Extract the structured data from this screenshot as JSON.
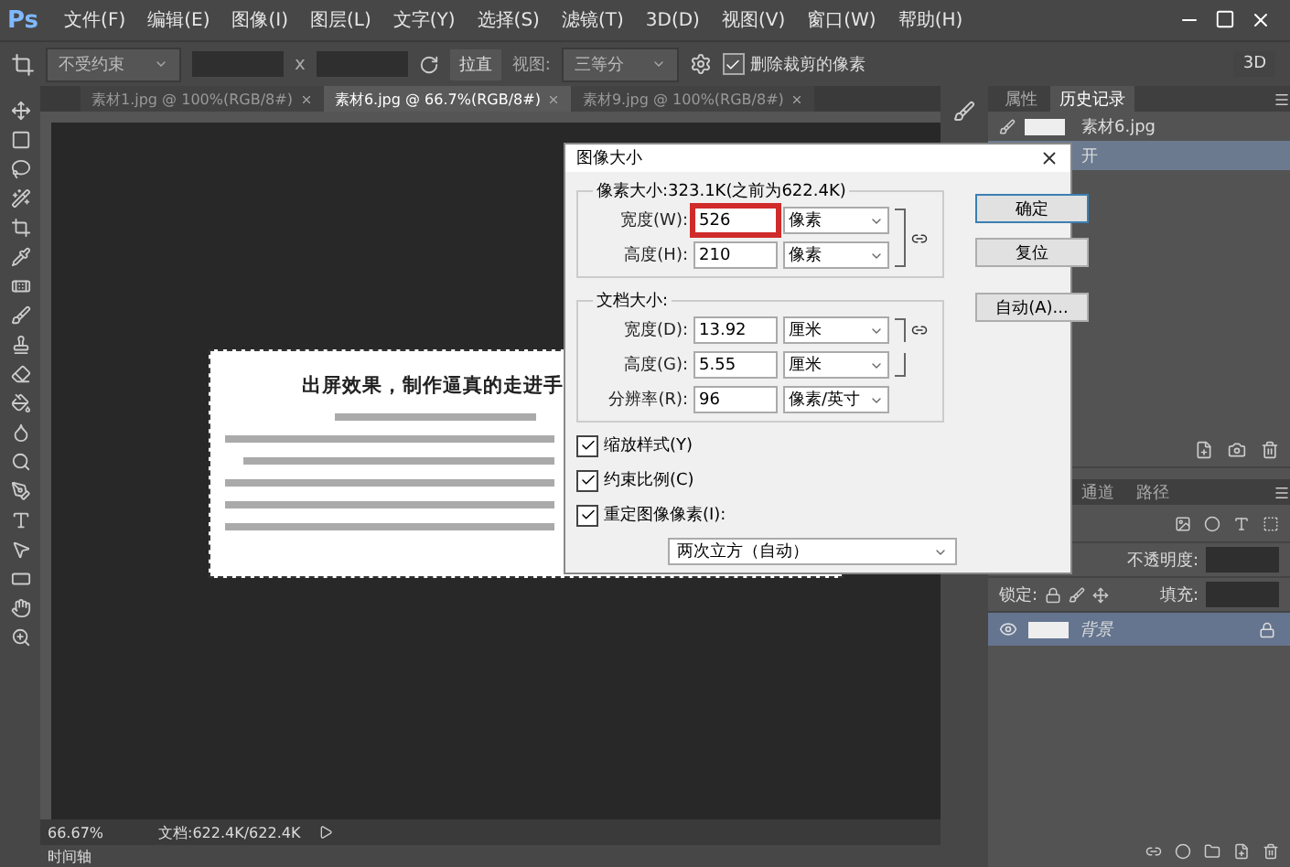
{
  "app": {
    "logo": "Ps"
  },
  "menu": [
    "文件(F)",
    "编辑(E)",
    "图像(I)",
    "图层(L)",
    "文字(Y)",
    "选择(S)",
    "滤镜(T)",
    "3D(D)",
    "视图(V)",
    "窗口(W)",
    "帮助(H)"
  ],
  "options_bar": {
    "ratio": "不受约束",
    "separator": "x",
    "straighten": "拉直",
    "view_label": "视图:",
    "view": "三等分",
    "delete_cropped": {
      "label": "删除裁剪的像素",
      "checked": true
    },
    "mode": "3D"
  },
  "doc_tabs": [
    {
      "label": "素材1.jpg @ 100%(RGB/8#)",
      "selected": false
    },
    {
      "label": "素材6.jpg @ 66.7%(RGB/8#)",
      "selected": true
    },
    {
      "label": "素材9.jpg @ 100%(RGB/8#)",
      "selected": false
    }
  ],
  "document": {
    "title": "出屏效果，制作逼真的走进手"
  },
  "history_panel": {
    "tabs": [
      {
        "label": "属性",
        "selected": false
      },
      {
        "label": "历史记录",
        "selected": true
      }
    ],
    "items": [
      {
        "kind": "snapshot",
        "label": "素材6.jpg",
        "selected": false
      },
      {
        "kind": "step",
        "label": "开",
        "selected": true
      }
    ]
  },
  "layers_panel": {
    "tabs": [
      {
        "label": "通道",
        "selected": false
      },
      {
        "label": "路径",
        "selected": false
      }
    ],
    "opacity_label": "不透明度:",
    "lock_label": "锁定:",
    "fill_label": "填充:",
    "layers": [
      {
        "name": "背景",
        "visible": true,
        "locked": true,
        "selected": true
      }
    ]
  },
  "status_bar": {
    "zoom": "66.67%",
    "doc_info": "文档:622.4K/622.4K"
  },
  "timeline": {
    "label": "时间轴"
  },
  "dialog": {
    "title": "图像大小",
    "pixel_group": {
      "title": "像素大小:323.1K(之前为622.4K)",
      "fields": [
        {
          "label": "宽度(W):",
          "value": "526",
          "unit": "像素",
          "highlighted": true
        },
        {
          "label": "高度(H):",
          "value": "210",
          "unit": "像素",
          "highlighted": false
        }
      ]
    },
    "doc_group": {
      "title": "文档大小:",
      "fields": [
        {
          "label": "宽度(D):",
          "value": "13.92",
          "unit": "厘米",
          "linked": true
        },
        {
          "label": "高度(G):",
          "value": "5.55",
          "unit": "厘米",
          "linked": true
        },
        {
          "label": "分辨率(R):",
          "value": "96",
          "unit": "像素/英寸",
          "linked": false
        }
      ]
    },
    "options": [
      {
        "label": "缩放样式(Y)",
        "checked": true
      },
      {
        "label": "约束比例(C)",
        "checked": true
      },
      {
        "label": "重定图像像素(I):",
        "checked": true
      }
    ],
    "resample": "两次立方（自动）",
    "buttons": [
      {
        "label": "确定",
        "default": true
      },
      {
        "label": "复位",
        "default": false
      },
      {
        "label": "自动(A)...",
        "default": false
      }
    ]
  }
}
